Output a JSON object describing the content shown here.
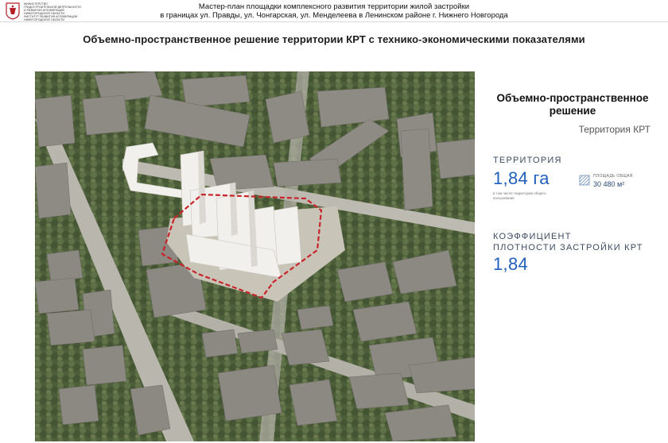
{
  "header": {
    "logo_lines": [
      "МИНИСТЕРСТВО",
      "ГРАДОСТРОИТЕЛЬНОЙ ДЕЯТЕЛЬНОСТИ",
      "И РАЗВИТИЯ АГЛОМЕРАЦИЙ",
      "НИЖЕГОРОДСКОЙ ОБЛАСТИ",
      "ИНСТИТУТ РАЗВИТИЯ АГЛОМЕРАЦИИ",
      "НИЖЕГОРОДСКОЙ ОБЛАСТИ"
    ],
    "title_line1": "Мастер-план площадки комплексного развития территории жилой застройки",
    "title_line2": "в границах ул. Правды, ул. Чонгарская, ул. Менделеева в Ленинском районе г. Нижнего Новгорода"
  },
  "slide_title": "Объемно-пространственное решение территории КРТ  с технико-экономическими показателями",
  "panel": {
    "heading": "Объемно-пространственное решение",
    "subheading": "Территория КРТ",
    "territory_label": "ТЕРРИТОРИЯ",
    "territory_value": "1,84 га",
    "territory_note": "в том числе территории общего пользования",
    "area_label": "ПЛОЩАДЬ ОБЩАЯ",
    "area_value": "30 480 м²",
    "density_label_line1": "КОЭФФИЦИЕНТ",
    "density_label_line2": "ПЛОТНОСТИ ЗАСТРОЙКИ КРТ",
    "density_value": "1,84"
  },
  "colors": {
    "accent_blue": "#1f5fbd",
    "boundary_red": "#c8242a",
    "label_navy": "#3c4a63"
  }
}
